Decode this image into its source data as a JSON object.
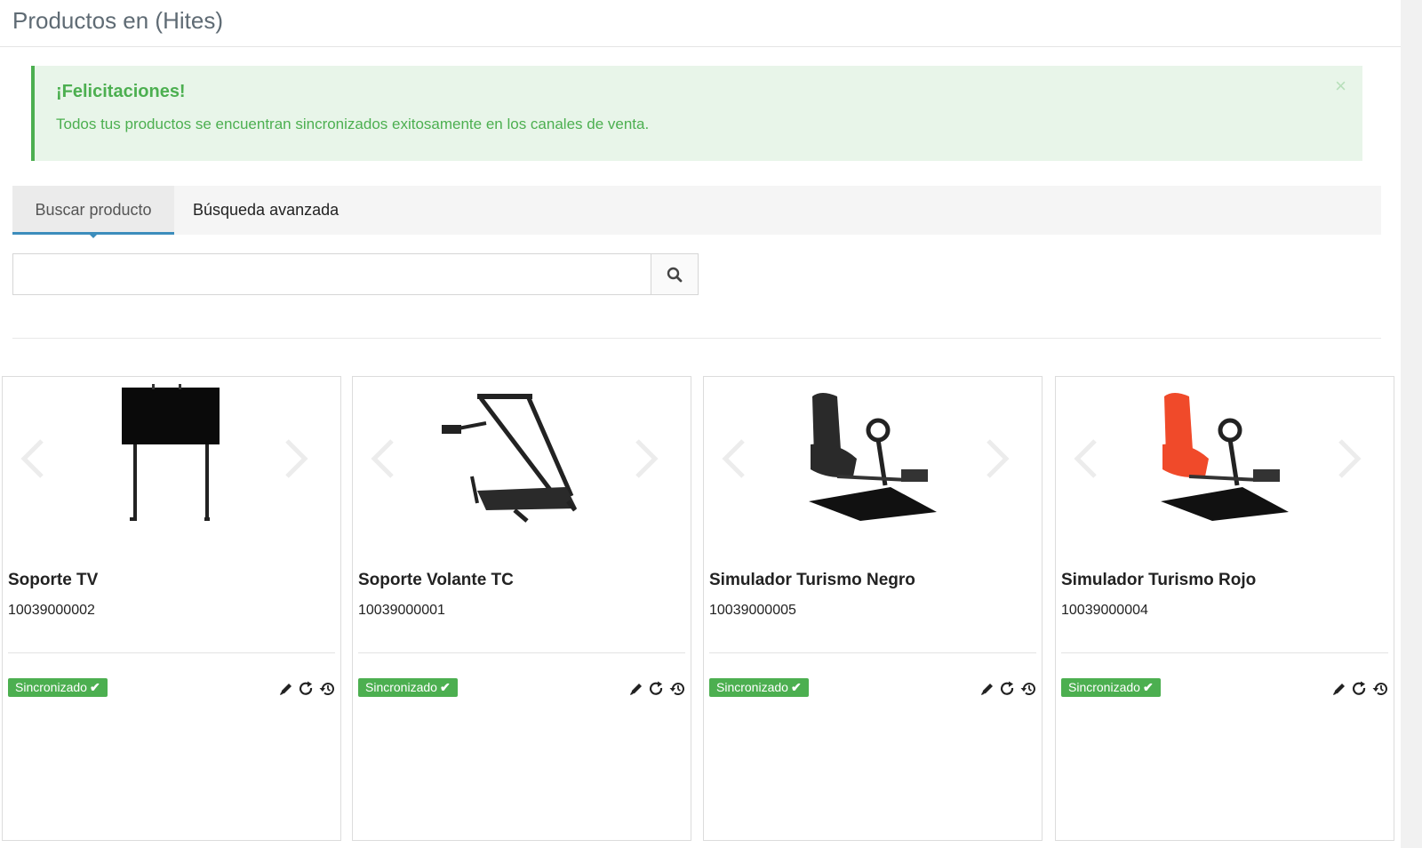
{
  "page": {
    "title": "Productos en (Hites)"
  },
  "alert": {
    "title": "¡Felicitaciones!",
    "message": "Todos tus productos se encuentran sincronizados exitosamente en los canales de venta.",
    "close": "×"
  },
  "tabs": [
    {
      "label": "Buscar producto",
      "active": true
    },
    {
      "label": "Búsqueda avanzada",
      "active": false
    }
  ],
  "search": {
    "value": "",
    "placeholder": ""
  },
  "products": [
    {
      "name": "Soporte TV",
      "sku": "10039000002",
      "status": "Sincronizado",
      "image_icon": "tv-stand-icon"
    },
    {
      "name": "Soporte Volante TC",
      "sku": "10039000001",
      "status": "Sincronizado",
      "image_icon": "wheel-stand-icon"
    },
    {
      "name": "Simulador Turismo Negro",
      "sku": "10039000005",
      "status": "Sincronizado",
      "image_icon": "racing-seat-black-icon"
    },
    {
      "name": "Simulador Turismo Rojo",
      "sku": "10039000004",
      "status": "Sincronizado",
      "image_icon": "racing-seat-red-icon"
    }
  ],
  "colors": {
    "accent": "#3c8dbc",
    "success": "#4caf50",
    "alert_bg": "#e8f5e9",
    "seat_black": "#2a2a2a",
    "seat_red": "#f04a2a"
  }
}
